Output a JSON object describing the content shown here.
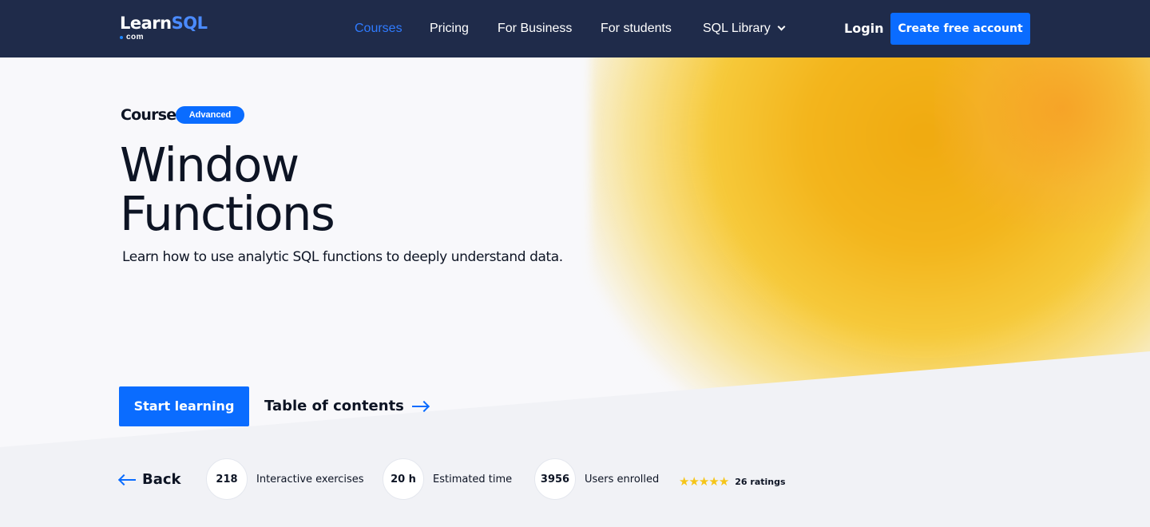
{
  "header": {
    "logo_brand": "Learn",
    "logo_brand_accent": "SQL",
    "logo_tld": "com",
    "nav": [
      {
        "label": "Courses",
        "active": true
      },
      {
        "label": "Pricing",
        "active": false
      },
      {
        "label": "For Business",
        "active": false
      },
      {
        "label": "For students",
        "active": false
      },
      {
        "label": "SQL Library",
        "active": false,
        "has_dropdown": true
      }
    ],
    "login_label": "Login",
    "cta_label": "Create free account"
  },
  "hero": {
    "kicker": "Course",
    "badge": "Advanced",
    "title_line1": "Window",
    "title_line2": "Functions",
    "subtitle": "Learn how to use analytic SQL functions to deeply understand data.",
    "start_label": "Start learning",
    "toc_label": "Table of contents"
  },
  "stats": {
    "back_label": "Back",
    "items": [
      {
        "value": "218",
        "label": "Interactive exercises"
      },
      {
        "value": "20 h",
        "label": "Estimated time"
      },
      {
        "value": "3956",
        "label": "Users enrolled"
      }
    ],
    "rating_stars": 5,
    "rating_label": "26 ratings"
  },
  "colors": {
    "header_bg": "#1f2b4a",
    "accent": "#0a6cff",
    "nav_active": "#2f7bff",
    "star": "#f5c518"
  },
  "icons": {
    "dropdown": "chevron-down-icon",
    "toc_arrow": "arrow-right-icon",
    "back_arrow": "arrow-left-icon",
    "star": "star-icon"
  }
}
